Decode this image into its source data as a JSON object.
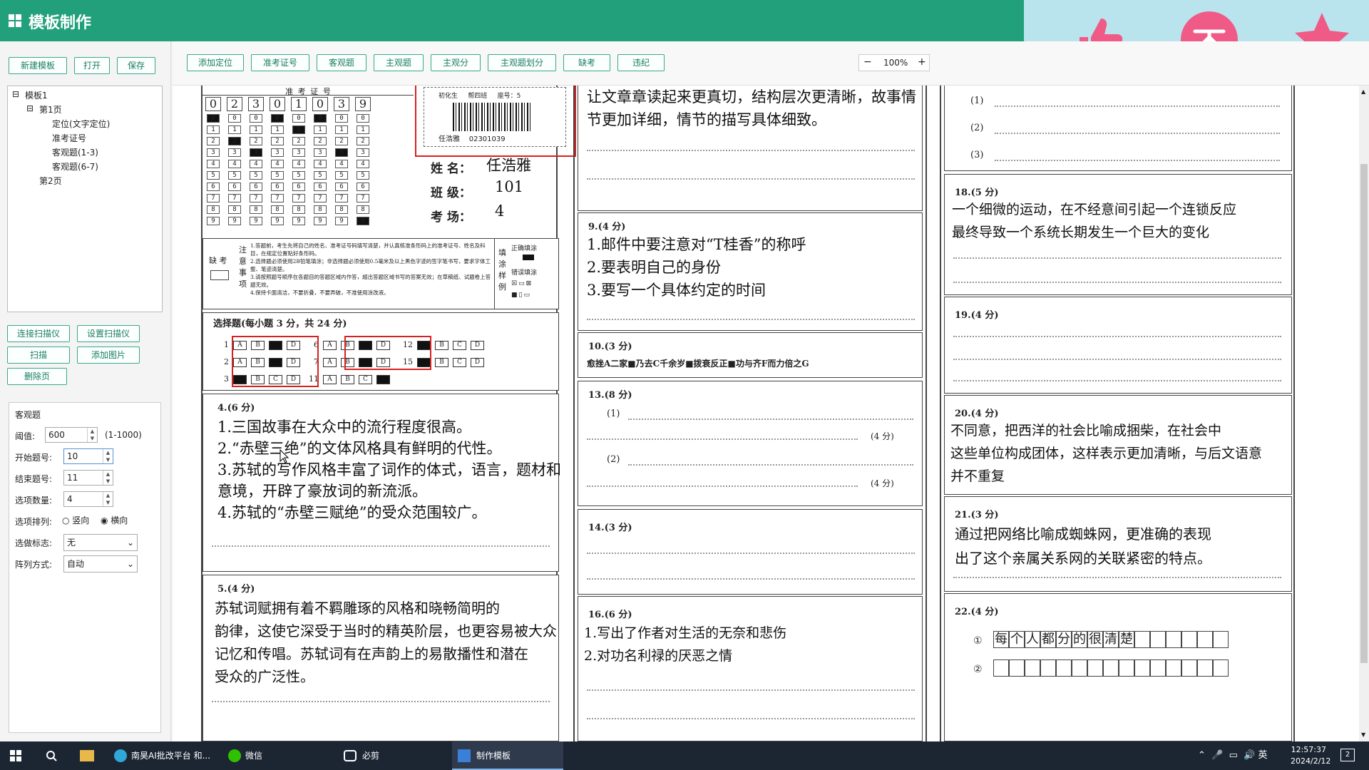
{
  "app": {
    "title": "模板制作"
  },
  "colors": {
    "accent": "#22a07c",
    "reaction_bg": "#b9e4ee",
    "reaction_icon": "#f05a87"
  },
  "reactions": [
    {
      "icon": "thumbs-up-icon"
    },
    {
      "icon": "dislike-icon"
    },
    {
      "icon": "star-icon"
    }
  ],
  "left": {
    "buttons": {
      "new": "新建模板",
      "open": "打开",
      "save": "保存",
      "connect": "连接扫描仪",
      "config": "设置扫描仪",
      "scan": "扫描",
      "add_image": "添加图片",
      "delete_page": "删除页"
    },
    "tree": {
      "root": "模板1",
      "page1": "第1页",
      "locate": "定位(文字定位)",
      "examno": "准考证号",
      "obj1": "客观题(1-3)",
      "obj2": "客观题(6-7)",
      "page2": "第2页"
    },
    "props": {
      "group_title": "客观题",
      "threshold_label": "阈值:",
      "threshold_value": "600",
      "threshold_range": "(1-1000)",
      "start_label": "开始题号:",
      "start_value": "10",
      "end_label": "结束题号:",
      "end_value": "11",
      "count_label": "选项数量:",
      "count_value": "4",
      "arrange_label": "选项排列:",
      "arrange_v": "竖向",
      "arrange_h": "横向",
      "mark_label": "选做标志:",
      "mark_value": "无",
      "array_label": "阵列方式:",
      "array_value": "自动"
    }
  },
  "toolbar": {
    "add_locate": "添加定位",
    "exam_no": "准考证号",
    "objective": "客观题",
    "subjective": "主观题",
    "sub_score": "主观分",
    "sub_split": "主观题划分",
    "absent": "缺考",
    "violation": "违纪",
    "zoom_minus": "−",
    "zoom": "100%",
    "zoom_plus": "+"
  },
  "sheet": {
    "exam_no_title": "准 考 证 号",
    "exam_no_digits": [
      "0",
      "2",
      "3",
      "0",
      "1",
      "0",
      "3",
      "9"
    ],
    "barcode_top": "初化生     帮四班     座号：5",
    "barcode_bottom": "任浩雅    02301039",
    "name_label": "姓  名：",
    "name_value": "任浩雅",
    "class_label": "班  级：",
    "class_value": "101",
    "room_label": "考  场：",
    "room_value": "4",
    "absent_label": "缺 考",
    "notice_label": "注意事项",
    "notice_text": [
      "1.答题前，考生先将自己的姓名、准考证号码填写清楚，并认真核准条形码上的准考证号、姓名及科目，在规定位置贴好条形码。",
      "2.选择题必须使用2B铅笔填涂；非选择题必须使用0.5毫米及以上黑色字迹的签字笔书写，要求字体工整、笔迹清楚。",
      "3.请按照题号顺序在各题目的答题区域内作答，超出答题区域书写的答案无效；在草稿纸、试题卷上答题无效。",
      "4.保持卡面清洁，不要折叠，不要弄破，不准使用涂改液。"
    ],
    "fill_label": "填涂样例",
    "fill_correct": "正确填涂",
    "fill_wrong": "错误填涂",
    "mc_title": "选择题(每小题 3 分，共 24 分)",
    "mc_rows": [
      {
        "n": "1",
        "opts": [
          "A",
          "B",
          "C",
          "D"
        ],
        "filled": [
          2
        ]
      },
      {
        "n": "2",
        "opts": [
          "A",
          "B",
          "C",
          "D"
        ],
        "filled": [
          2
        ]
      },
      {
        "n": "3",
        "opts": [
          "A",
          "B",
          "C",
          "D"
        ],
        "filled": [
          0
        ]
      },
      {
        "n": "6",
        "opts": [
          "A",
          "B",
          "C",
          "D"
        ],
        "filled": [
          2
        ]
      },
      {
        "n": "7",
        "opts": [
          "A",
          "B",
          "C",
          "D"
        ],
        "filled": [
          2
        ]
      },
      {
        "n": "11",
        "opts": [
          "A",
          "B",
          "C",
          "D"
        ],
        "filled": [
          3
        ]
      },
      {
        "n": "12",
        "opts": [
          "A",
          "B",
          "C",
          "D"
        ],
        "filled": [
          0
        ]
      },
      {
        "n": "15",
        "opts": [
          "A",
          "B",
          "C",
          "D"
        ],
        "filled": [
          0
        ]
      }
    ],
    "q4": {
      "head": "4.(6 分)",
      "lines": [
        "1.三国故事在大众中的流行程度很高。",
        "2.“赤壁三绝”的文体风格具有鲜明的代性。",
        "3.苏轼的写作风格丰富了词作的体式，语言，题材和",
        "意境，开辟了豪放词的新流派。",
        "4.苏轼的“赤壁三赋绝”的受众范围较广。"
      ]
    },
    "q5": {
      "head": "5.(4 分)",
      "lines": [
        "苏轼词赋拥有着不羁雕琢的风格和晓畅简明的",
        "韵律，这使它深受于当时的精英阶层，也更容易被大众",
        "记忆和传唱。苏轼词有在声韵上的易散播性和潜在",
        "受众的广泛性。"
      ]
    },
    "q8_lines": [
      "让文章章读起来更真切，结构层次更清晰，故事情",
      "节更加详细，情节的描写具体细致。"
    ],
    "q9": {
      "head": "9.(4 分)",
      "lines": [
        "1.邮件中要注意对“T桂香”的称呼",
        "2.要表明自己的身份",
        "3.要写一个具体约定的时间"
      ]
    },
    "q10": {
      "head": "10.(3 分)",
      "text": "愈挫A二家■乃去C千余岁■拨衰反正■功与齐F而力倍之G"
    },
    "q13": {
      "head": "13.(8 分)",
      "p1": "(1)",
      "p2": "(2)",
      "s1": "(4 分)",
      "s2": "(4 分)"
    },
    "q14": {
      "head": "14.(3 分)"
    },
    "q16": {
      "head": "16.(6 分)",
      "lines": [
        "1.写出了作者对生活的无奈和悲伤",
        "2.对功名利禄的厌恶之情"
      ]
    },
    "q17": {
      "p1": "(1)",
      "p2": "(2)",
      "p3": "(3)"
    },
    "q18": {
      "head": "18.(5 分)",
      "lines": [
        "一个细微的运动，在不经意间引起一个连锁反应",
        "最终导致一个系统长期发生一个巨大的变化"
      ]
    },
    "q19": {
      "head": "19.(4 分)"
    },
    "q20": {
      "head": "20.(4 分)",
      "lines": [
        "不同意，把西洋的社会比喻成捆柴，在社会中",
        "这些单位构成团体，这样表示更加清晰，与后文语意",
        "并不重复"
      ]
    },
    "q21": {
      "head": "21.(3 分)",
      "lines": [
        "通过把网络比喻成蜘蛛网，更准确的表现",
        "出了这个亲属关系网的关联紧密的特点。"
      ]
    },
    "q22": {
      "head": "22.(4 分)",
      "n1": "①",
      "n2": "②",
      "chars": [
        "每",
        "个",
        "人",
        "都",
        "分",
        "的",
        "很",
        "清",
        "楚"
      ]
    }
  },
  "taskbar": {
    "items": [
      "南昊AI批改平台 和...",
      "微信",
      "必剪",
      "制作模板"
    ],
    "time": "12:57:37",
    "date": "2024/2/12",
    "ime": "英",
    "notif": "2"
  }
}
